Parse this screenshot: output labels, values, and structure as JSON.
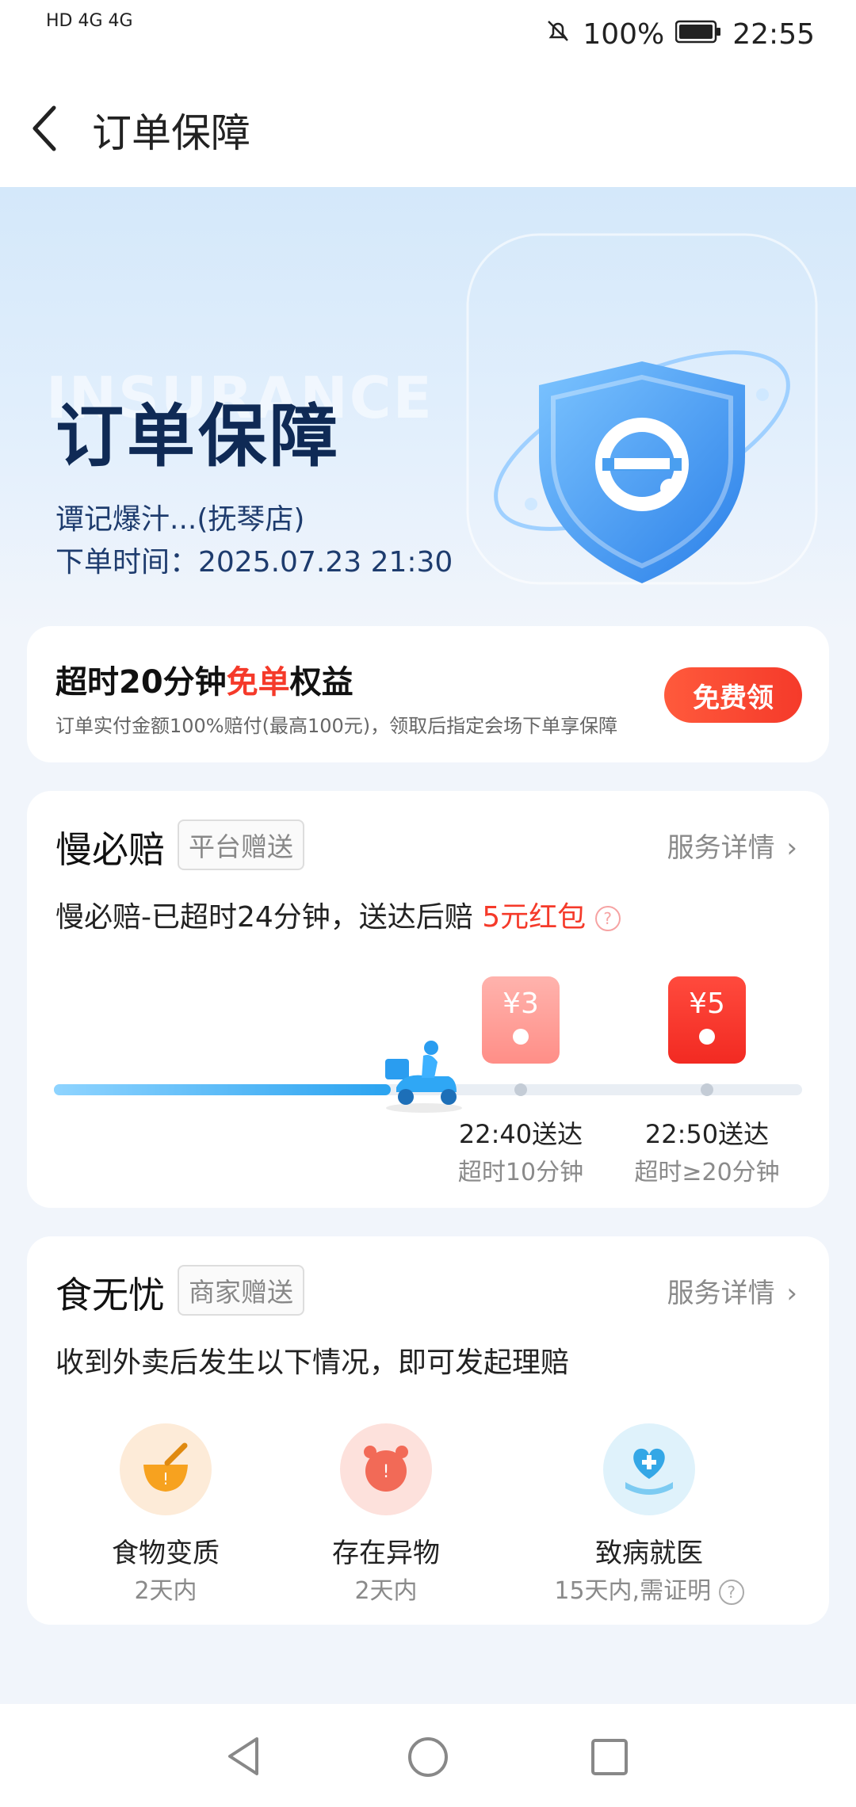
{
  "status_bar": {
    "left_text": "HD 4G 4G",
    "battery": "100%",
    "time": "22:55"
  },
  "nav": {
    "back_icon": "back-arrow-icon",
    "title": "订单保障"
  },
  "hero": {
    "watermark": "INSURANCE",
    "title": "订单保障",
    "store": "谭记爆汁...(抚琴店)",
    "order_time": "下单时间：2025.07.23 21:30"
  },
  "benefit": {
    "title_prefix": "超时20分钟",
    "title_highlight": "免单",
    "title_suffix": "权益",
    "desc": "订单实付金额100%赔付(最高100元)，领取后指定会场下单享保障",
    "button": "免费领"
  },
  "slow_pay": {
    "title": "慢必赔",
    "tag": "平台赠送",
    "detail": "服务详情",
    "status_prefix": "慢必赔-已超时24分钟，送达后赔",
    "status_highlight": "5元红包",
    "progress": 0.45,
    "milestones": [
      {
        "amount": "¥3",
        "time": "22:40送达",
        "sub": "超时10分钟"
      },
      {
        "amount": "¥5",
        "time": "22:50送达",
        "sub": "超时≥20分钟"
      }
    ]
  },
  "food_safe": {
    "title": "食无忧",
    "tag": "商家赠送",
    "detail": "服务详情",
    "desc": "收到外卖后发生以下情况，即可发起理赔",
    "items": [
      {
        "label": "食物变质",
        "sub": "2天内"
      },
      {
        "label": "存在异物",
        "sub": "2天内"
      },
      {
        "label": "致病就医",
        "sub": "15天内,需证明"
      }
    ]
  },
  "colors": {
    "accent_red": "#f53a2a",
    "brand_blue": "#2aa3f0"
  }
}
